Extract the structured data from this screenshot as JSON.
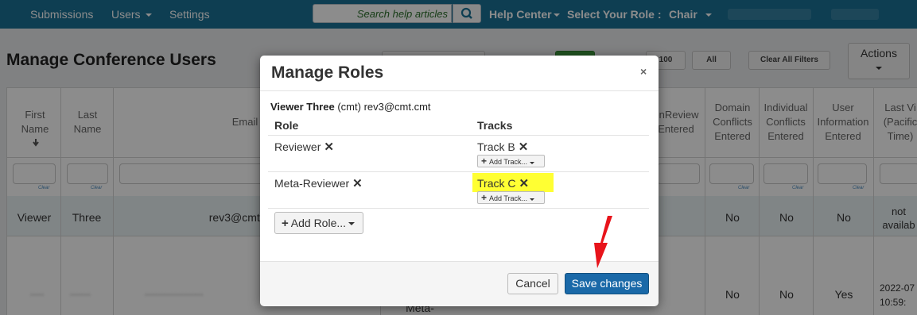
{
  "nav": {
    "items": [
      {
        "label": "Submissions"
      },
      {
        "label": "Users"
      },
      {
        "label": "Settings"
      }
    ],
    "search_placeholder": "Search help articles",
    "help_center": "Help Center",
    "role_label": "Select Your Role :",
    "role_value": "Chair"
  },
  "page": {
    "title": "Manage Conference Users",
    "btn_100": "100",
    "btn_all": "All",
    "btn_clear_filters": "Clear All Filters",
    "actions": "Actions"
  },
  "table": {
    "headers": {
      "first_name": "First Name",
      "last_name": "Last Name",
      "email": "Email",
      "openreview": "enReview Entered",
      "domain_conflicts": "Domain Conflicts Entered",
      "individual_conflicts": "Individual Conflicts Entered",
      "user_info": "User Information Entered",
      "last_visit": "Last Vi (Pacific Time)"
    },
    "clear_label": "Clear",
    "row1": {
      "first": "Viewer",
      "last": "Three",
      "email": "rev3@cmt.cmt",
      "domain": "No",
      "individual": "No",
      "user_info": "No",
      "last_visit": "not availab"
    },
    "row2": {
      "meta": "Meta-",
      "domain": "No",
      "individual": "No",
      "user_info": "Yes",
      "last_visit_date": "2022-07",
      "last_visit_time": "10:59:"
    }
  },
  "modal": {
    "title": "Manage Roles",
    "close": "×",
    "user_name": "Viewer Three",
    "user_tag": "(cmt)",
    "user_email": "rev3@cmt.cmt",
    "col_role": "Role",
    "col_tracks": "Tracks",
    "rows": [
      {
        "role": "Reviewer",
        "track": "Track B",
        "add_track": "Add Track..."
      },
      {
        "role": "Meta-Reviewer",
        "track": "Track C",
        "add_track": "Add Track..."
      }
    ],
    "add_role": "Add Role...",
    "cancel": "Cancel",
    "save": "Save changes"
  },
  "colors": {
    "nav": "#1b7196",
    "primary": "#1a69a8",
    "highlight": "#ffff33",
    "arrow": "#e8141b"
  }
}
